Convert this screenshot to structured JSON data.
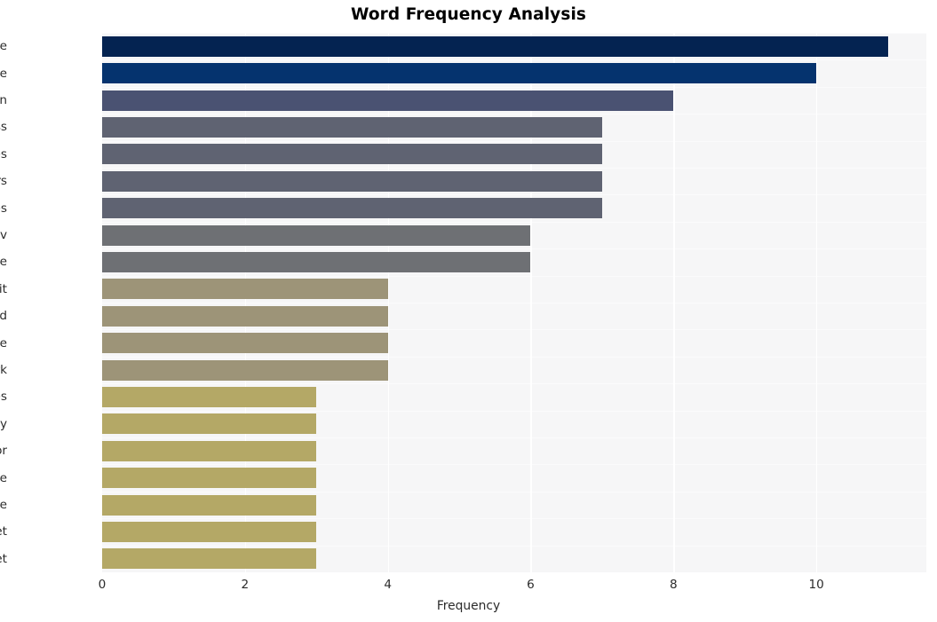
{
  "chart_data": {
    "type": "bar",
    "orientation": "horizontal",
    "title": "Word Frequency Analysis",
    "xlabel": "Frequency",
    "ylabel": "",
    "categories": [
      "service",
      "edge",
      "exploitation",
      "mass",
      "cves",
      "attackers",
      "devices",
      "kev",
      "infrastructure",
      "exploit",
      "add",
      "vulnerable",
      "network",
      "vulnerabilities",
      "primary",
      "vector",
      "software",
      "attractive",
      "target",
      "internet"
    ],
    "values": [
      11,
      10,
      8,
      7,
      7,
      7,
      7,
      6,
      6,
      4,
      4,
      4,
      4,
      3,
      3,
      3,
      3,
      3,
      3,
      3
    ],
    "bar_colors": [
      "#042351",
      "#05336e",
      "#4a5272",
      "#5f6372",
      "#5f6372",
      "#5f6372",
      "#5f6372",
      "#6e7074",
      "#6e7074",
      "#9d9478",
      "#9d9478",
      "#9d9478",
      "#9d9478",
      "#b4a866",
      "#b4a866",
      "#b4a866",
      "#b4a866",
      "#b4a866",
      "#b4a866",
      "#b4a866"
    ],
    "xticks": [
      0,
      2,
      4,
      6,
      8,
      10
    ],
    "xlim": [
      0,
      11.54
    ],
    "grid": true,
    "grid_axis": "both",
    "legend": "none",
    "plot_background": "#f6f6f7",
    "figure_background": "#ffffff",
    "tick_label_color": "#2b2b2b"
  }
}
